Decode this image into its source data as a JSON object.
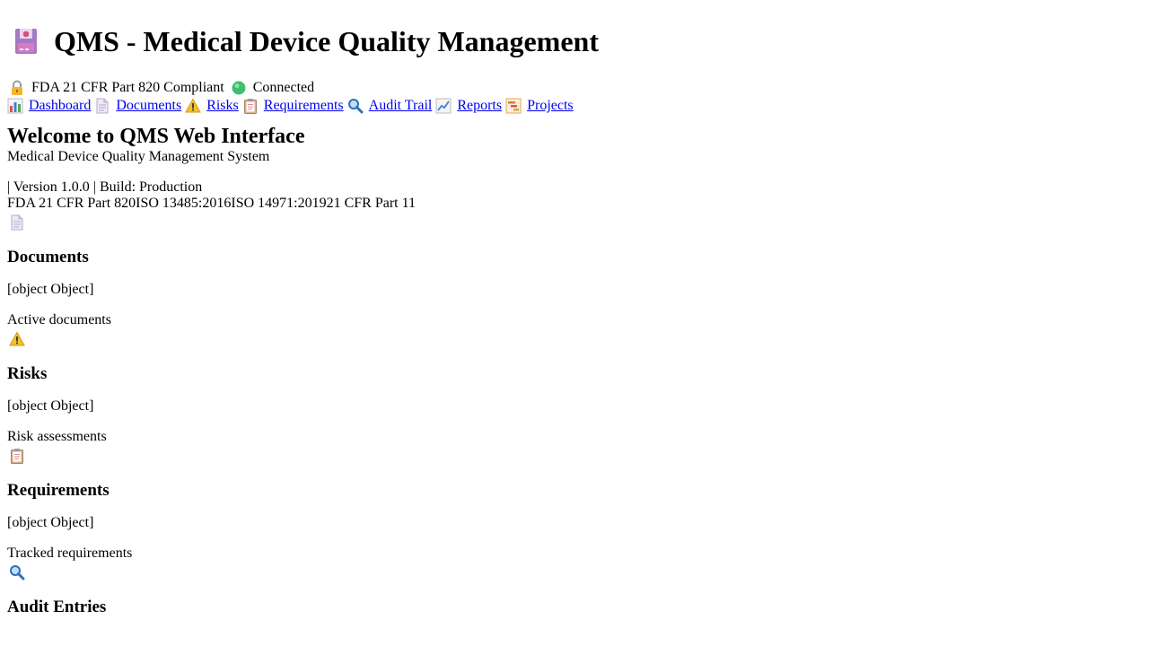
{
  "header": {
    "icon": "floppy-disk-icon",
    "title": "QMS - Medical Device Quality Management"
  },
  "status": {
    "compliance_icon": "lock-icon",
    "compliance_text": "FDA 21 CFR Part 820 Compliant",
    "connection_icon": "green-circle-icon",
    "connection_text": "Connected"
  },
  "nav": [
    {
      "icon": "bar-chart-icon",
      "label": " Dashboard"
    },
    {
      "icon": "document-icon",
      "label": " Documents"
    },
    {
      "icon": "warning-icon",
      "label": " Risks"
    },
    {
      "icon": "clipboard-icon",
      "label": " Requirements"
    },
    {
      "icon": "magnifier-icon",
      "label": " Audit Trail"
    },
    {
      "icon": "line-chart-icon",
      "label": " Reports"
    },
    {
      "icon": "projects-icon",
      "label": " Projects"
    }
  ],
  "welcome": {
    "heading": "Welcome to QMS Web Interface",
    "subtitle": "Medical Device Quality Management System",
    "version_line": "| Version 1.0.0 | Build: Production",
    "compliance_line": "FDA 21 CFR Part 820ISO 13485:2016ISO 14971:201921 CFR Part 11"
  },
  "cards": [
    {
      "icon": "document-icon",
      "title": "Documents",
      "value": "[object Object]",
      "description": "Active documents"
    },
    {
      "icon": "warning-icon",
      "title": "Risks",
      "value": "[object Object]",
      "description": "Risk assessments"
    },
    {
      "icon": "clipboard-icon",
      "title": "Requirements",
      "value": "[object Object]",
      "description": "Tracked requirements"
    },
    {
      "icon": "magnifier-icon",
      "title": "Audit Entries"
    }
  ],
  "colors": {
    "link": "#0000ee",
    "status_green": "#3fbf6f",
    "warning_yellow": "#f2c12e"
  }
}
